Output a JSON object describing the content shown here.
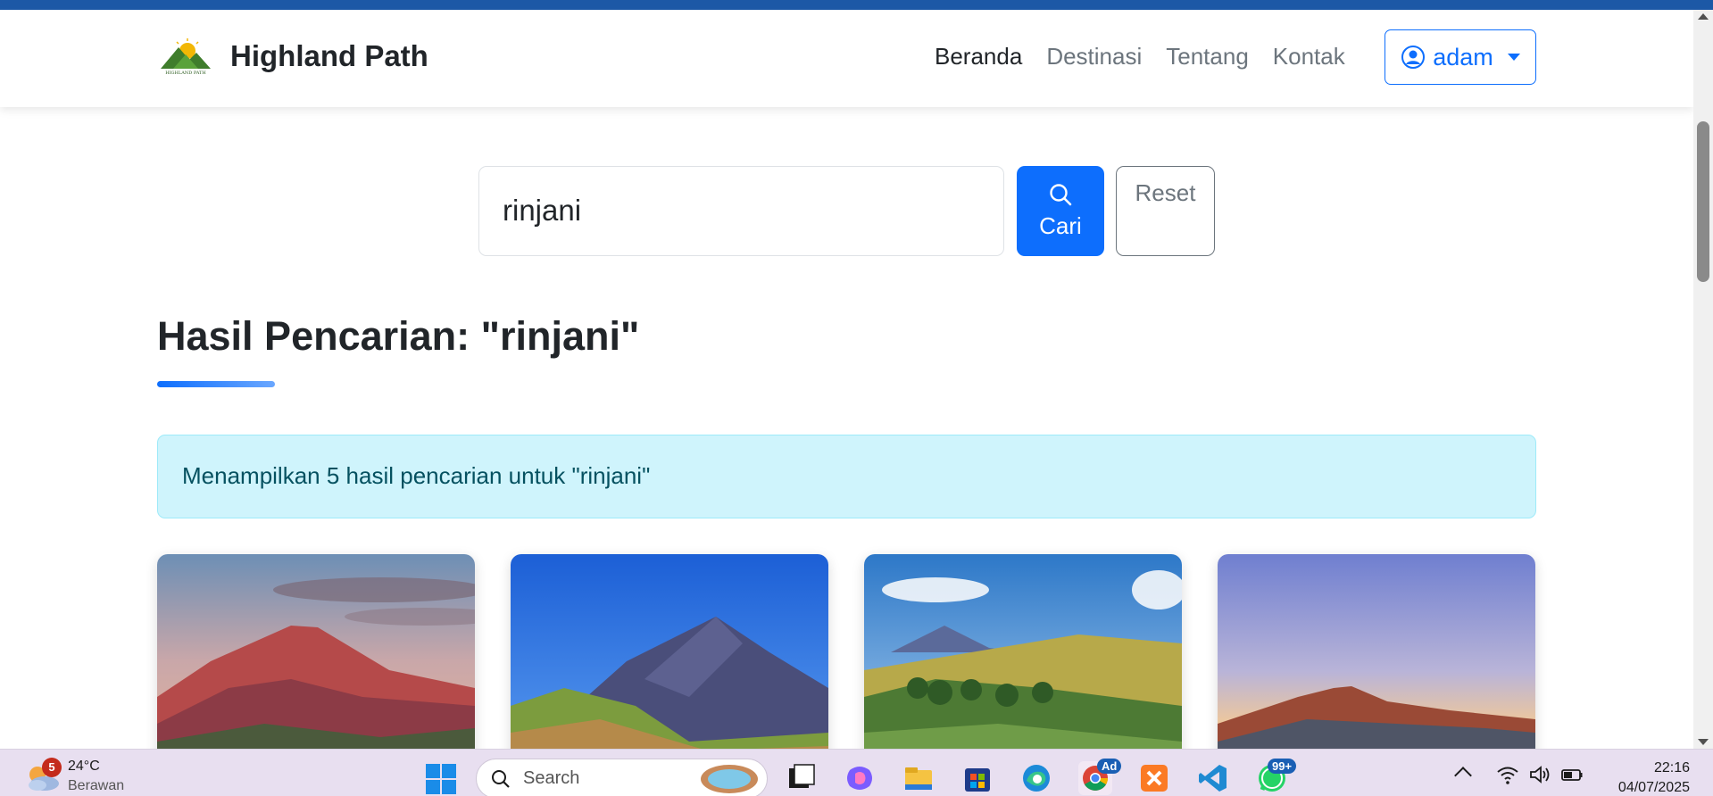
{
  "navbar": {
    "brand": "Highland Path",
    "links": [
      {
        "label": "Beranda",
        "active": true
      },
      {
        "label": "Destinasi",
        "active": false
      },
      {
        "label": "Tentang",
        "active": false
      },
      {
        "label": "Kontak",
        "active": false
      }
    ],
    "user": "adam"
  },
  "search": {
    "value": "rinjani",
    "button_label": "Cari",
    "reset_label": "Reset"
  },
  "results": {
    "title": "Hasil Pencarian: \"rinjani\"",
    "alert": "Menampilkan 5 hasil pencarian untuk \"rinjani\""
  },
  "cards": [
    {
      "image": "rinjani-sunset-mountain"
    },
    {
      "image": "rinjani-blue-sky-peak"
    },
    {
      "image": "rinjani-green-savanna"
    },
    {
      "image": "rinjani-dusk-silhouette"
    }
  ],
  "taskbar": {
    "weather_temp": "24°C",
    "weather_cond": "Berawan",
    "weather_badge": "5",
    "search_placeholder": "Search",
    "chrome_badge": "Ad",
    "whatsapp_badge": "99+",
    "time": "22:16",
    "date": "04/07/2025"
  },
  "colors": {
    "primary": "#0d6efd",
    "alert_bg": "#cff4fc",
    "alert_text": "#055160",
    "topbar": "#1c58a6",
    "taskbar": "#e8dff0"
  }
}
